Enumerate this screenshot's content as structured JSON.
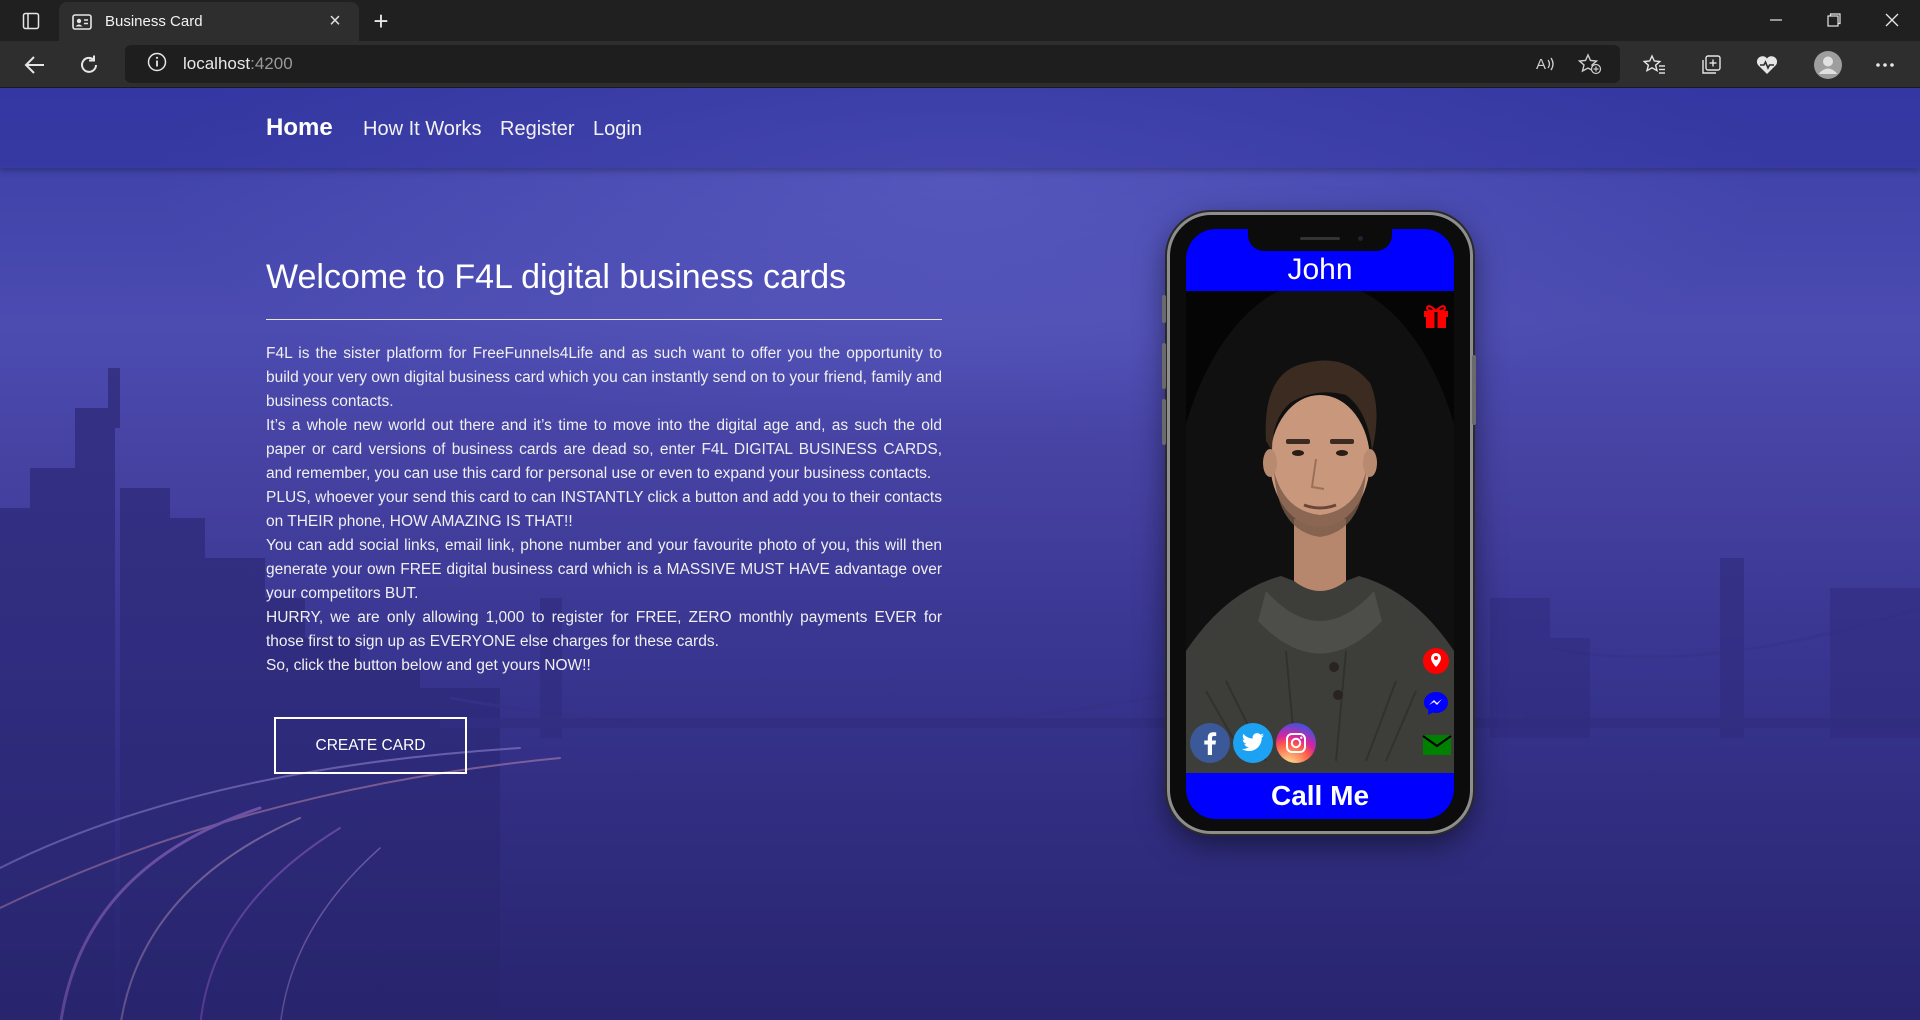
{
  "browser": {
    "tab_title": "Business Card",
    "url_host": "localhost",
    "url_port": ":4200"
  },
  "nav": {
    "home": "Home",
    "how_it_works": "How It Works",
    "register": "Register",
    "login": "Login"
  },
  "hero": {
    "title": "Welcome to F4L digital business cards",
    "paragraphs": [
      "F4L is the sister platform for FreeFunnels4Life and as such want to offer you the opportunity to build your very own digital business card which you can instantly send on to your friend, family and business contacts.",
      "It’s a whole new world out there and it’s time to move into the digital age and, as such the old paper or card versions of business cards are dead so, enter F4L DIGITAL BUSINESS CARDS, and remember, you can use this card for personal use or even to expand your business contacts.",
      "PLUS, whoever your send this card to can INSTANTLY click a button and add you to their contacts on THEIR phone, HOW AMAZING IS THAT!!",
      "You can add social links, email link, phone number and your favourite photo of you, this will then generate your own FREE digital business card which is a MASSIVE MUST HAVE advantage over your competitors BUT.",
      "HURRY, we are only allowing 1,000 to register for FREE, ZERO monthly payments EVER for those first to sign up as EVERYONE else charges for these cards.",
      "So, click the button below and get yours NOW!!"
    ],
    "cta": "CREATE CARD"
  },
  "card": {
    "name": "John",
    "call_label": "Call Me",
    "icons": [
      "gift-icon",
      "map-pin-icon",
      "messenger-icon",
      "mail-icon"
    ],
    "socials": [
      "facebook-icon",
      "twitter-icon",
      "instagram-icon"
    ],
    "colors": {
      "header": "#0000ff",
      "gift": "#ff0000",
      "messenger": "#0000ff",
      "mail": "#008000"
    }
  }
}
